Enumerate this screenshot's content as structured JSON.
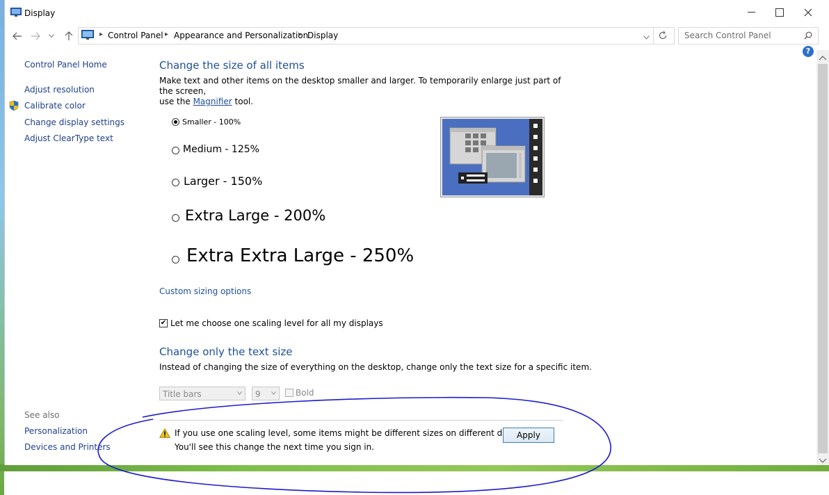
{
  "window": {
    "title": "Display",
    "controls": {
      "minimize": "minimize",
      "maximize": "maximize",
      "close": "close"
    }
  },
  "address": {
    "breadcrumbs": [
      "Control Panel",
      "Appearance and Personalization",
      "Display"
    ],
    "search_placeholder": "Search Control Panel"
  },
  "sidebar": {
    "links": [
      "Control Panel Home",
      "Adjust resolution",
      "Calibrate color",
      "Change display settings",
      "Adjust ClearType text"
    ],
    "see_also_label": "See also",
    "see_also_links": [
      "Personalization",
      "Devices and Printers"
    ]
  },
  "main": {
    "heading1": "Change the size of all items",
    "desc1_part1": "Make text and other items on the desktop smaller and larger. To temporarily enlarge just part of the screen,",
    "desc1_part2": "use the",
    "magnifier_link": "Magnifier",
    "desc1_part3": "tool.",
    "options": [
      {
        "label": "Smaller - 100%",
        "selected": true
      },
      {
        "label": "Medium - 125%",
        "selected": false
      },
      {
        "label": "Larger - 150%",
        "selected": false
      },
      {
        "label": "Extra Large - 200%",
        "selected": false
      },
      {
        "label": "Extra Extra Large - 250%",
        "selected": false
      }
    ],
    "custom_sizing_link": "Custom sizing options",
    "one_scaling_checkbox": {
      "label": "Let me choose one scaling level for all my displays",
      "checked": true
    },
    "heading2": "Change only the text size",
    "desc2": "Instead of changing the size of everything on the desktop, change only the text size for a specific item.",
    "item_select": {
      "value": "Title bars"
    },
    "size_select": {
      "value": "9"
    },
    "bold_checkbox": {
      "label": "Bold",
      "checked": false
    },
    "warning_line1": "If you use one scaling level, some items might be different sizes on different displays.",
    "warning_line2": "You'll see this change the next time you sign in.",
    "apply_label": "Apply"
  },
  "colors": {
    "link": "#1e4f9a",
    "heading": "#1e4f9a",
    "annotation_circle": "#1a1ad0"
  }
}
